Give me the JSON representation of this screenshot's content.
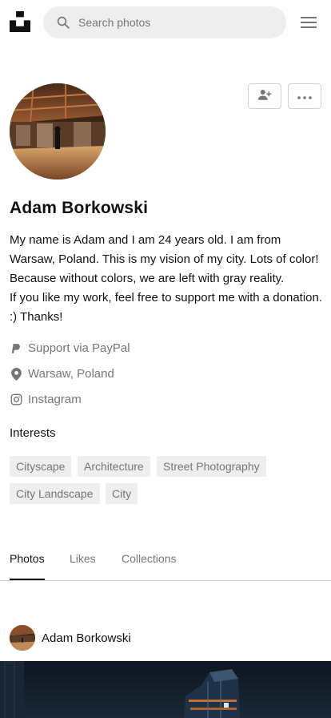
{
  "header": {
    "search_placeholder": "Search photos"
  },
  "profile": {
    "name": "Adam Borkowski",
    "bio_lines": [
      "My name is Adam and I am 24 years old. I am from Warsaw, Poland. This is my vision of my city. Lots of color! Because without colors, we are left with gray reality.",
      "If you like my work, feel free to support me with a donation. :) Thanks!"
    ],
    "paypal_label": "Support via PayPal",
    "location": "Warsaw, Poland",
    "instagram_label": "Instagram"
  },
  "interests": {
    "title": "Interests",
    "tags": [
      "Cityscape",
      "Architecture",
      "Street Photography",
      "City Landscape",
      "City"
    ]
  },
  "tabs": {
    "items": [
      "Photos",
      "Likes",
      "Collections"
    ],
    "active": "Photos"
  },
  "feed": {
    "author_name": "Adam Borkowski"
  },
  "icons": {
    "logo": "unsplash-logo-icon",
    "search": "search-icon",
    "menu": "hamburger-menu-icon",
    "follow": "person-add-icon",
    "more": "more-horizontal-icon",
    "paypal": "paypal-icon",
    "location": "location-pin-icon",
    "instagram": "instagram-icon"
  },
  "colors": {
    "text_primary": "#111111",
    "text_secondary": "#767676",
    "tag_background": "#eeeeee",
    "border": "#d1d1d1"
  }
}
